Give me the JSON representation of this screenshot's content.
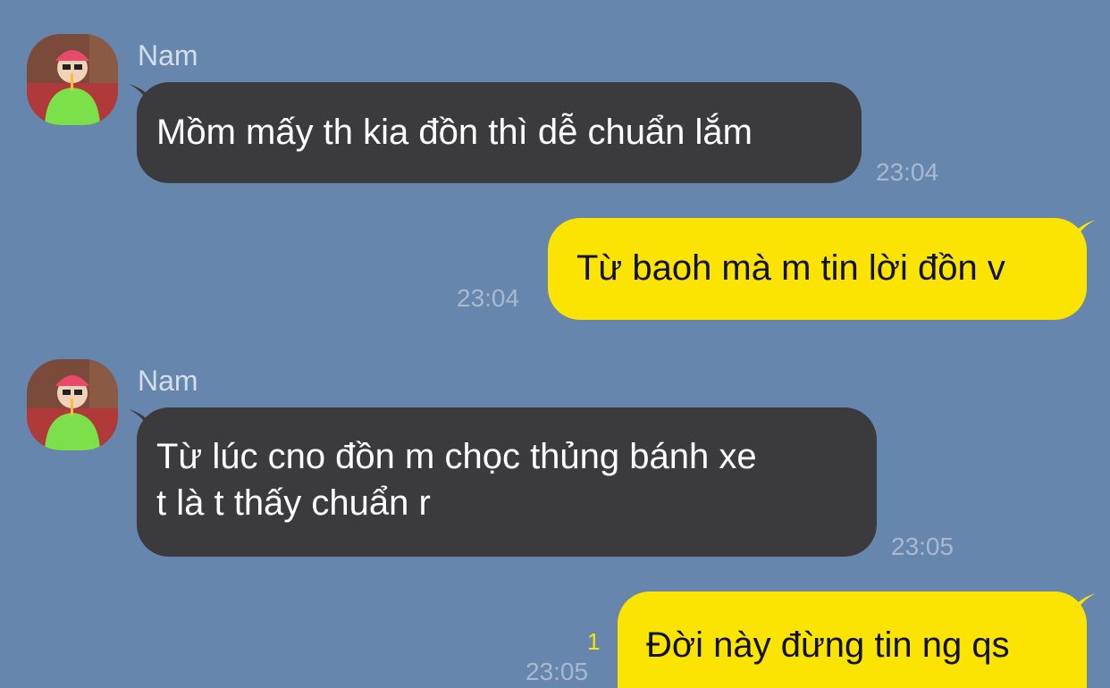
{
  "colors": {
    "background": "#6686ad",
    "incoming_bubble": "#3b3b3d",
    "outgoing_bubble": "#fbe402",
    "timestamp": "#a8b9cf",
    "unread": "#fbe402"
  },
  "messages": [
    {
      "direction": "incoming",
      "sender": "Nam",
      "text": "Mồm mấy th kia đồn thì dễ chuẩn lắm",
      "time": "23:04"
    },
    {
      "direction": "outgoing",
      "text": "Từ baoh mà m tin lời đồn v",
      "time": "23:04"
    },
    {
      "direction": "incoming",
      "sender": "Nam",
      "lines": [
        "Từ lúc cno đồn m chọc thủng bánh xe",
        "t là t thấy chuẩn r"
      ],
      "time": "23:05"
    },
    {
      "direction": "outgoing",
      "text": "Đời này đừng tin ng qs",
      "time": "23:05",
      "unread_count": "1"
    }
  ]
}
